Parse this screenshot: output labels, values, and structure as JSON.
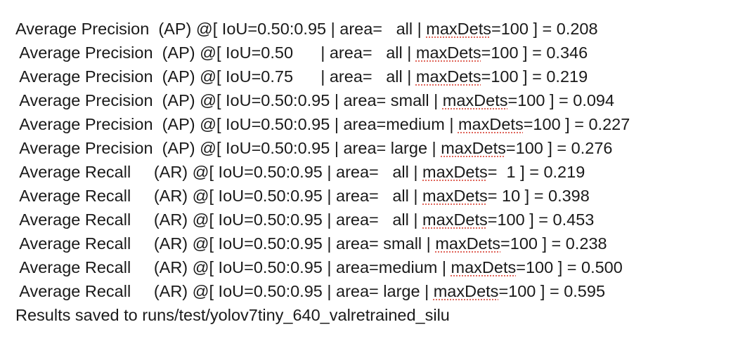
{
  "lines": [
    {
      "before": "Average Precision  (AP) @[ IoU=0.50:0.95 | area=   all | ",
      "flagged": "maxDets",
      "after": "=100 ] = 0.208"
    },
    {
      "before": " Average Precision  (AP) @[ IoU=0.50      | area=   all | ",
      "flagged": "maxDets",
      "after": "=100 ] = 0.346"
    },
    {
      "before": " Average Precision  (AP) @[ IoU=0.75      | area=   all | ",
      "flagged": "maxDets",
      "after": "=100 ] = 0.219"
    },
    {
      "before": " Average Precision  (AP) @[ IoU=0.50:0.95 | area= small | ",
      "flagged": "maxDets",
      "after": "=100 ] = 0.094"
    },
    {
      "before": " Average Precision  (AP) @[ IoU=0.50:0.95 | area=medium | ",
      "flagged": "maxDets",
      "after": "=100 ] = 0.227"
    },
    {
      "before": " Average Precision  (AP) @[ IoU=0.50:0.95 | area= large | ",
      "flagged": "maxDets",
      "after": "=100 ] = 0.276"
    },
    {
      "before": " Average Recall     (AR) @[ IoU=0.50:0.95 | area=   all | ",
      "flagged": "maxDets",
      "after": "=  1 ] = 0.219"
    },
    {
      "before": " Average Recall     (AR) @[ IoU=0.50:0.95 | area=   all | ",
      "flagged": "maxDets",
      "after": "= 10 ] = 0.398"
    },
    {
      "before": " Average Recall     (AR) @[ IoU=0.50:0.95 | area=   all | ",
      "flagged": "maxDets",
      "after": "=100 ] = 0.453"
    },
    {
      "before": " Average Recall     (AR) @[ IoU=0.50:0.95 | area= small | ",
      "flagged": "maxDets",
      "after": "=100 ] = 0.238"
    },
    {
      "before": " Average Recall     (AR) @[ IoU=0.50:0.95 | area=medium | ",
      "flagged": "maxDets",
      "after": "=100 ] = 0.500"
    },
    {
      "before": " Average Recall     (AR) @[ IoU=0.50:0.95 | area= large | ",
      "flagged": "maxDets",
      "after": "=100 ] = 0.595"
    }
  ],
  "results_line": "Results saved to runs/test/yolov7tiny_640_valretrained_silu",
  "spellcheck_color": "#e0655a",
  "text_color": "#1a1a1a"
}
